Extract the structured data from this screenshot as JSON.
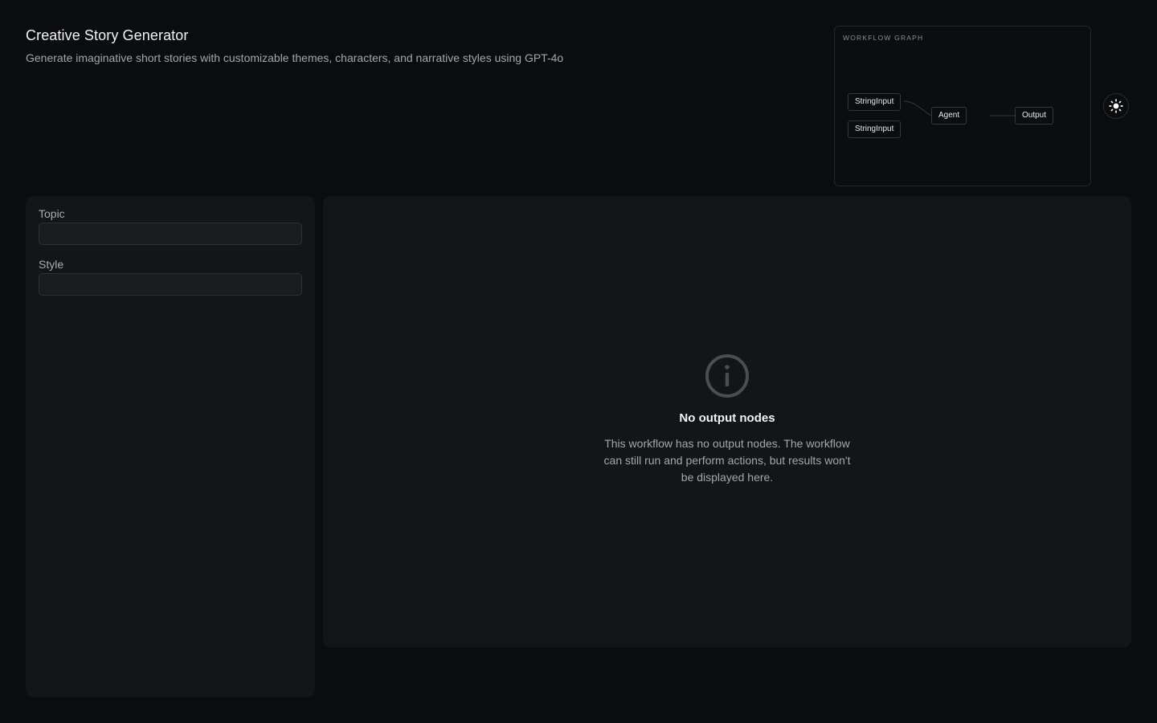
{
  "header": {
    "title": "Creative Story Generator",
    "subtitle": "Generate imaginative short stories with customizable themes, characters, and narrative styles using GPT-4o"
  },
  "workflow_graph": {
    "label": "WORKFLOW GRAPH",
    "nodes": [
      "StringInput",
      "StringInput",
      "Agent",
      "Output"
    ]
  },
  "theme_toggle": {
    "icon": "sun-icon"
  },
  "inputs": {
    "fields": [
      {
        "label": "Topic",
        "value": "",
        "placeholder": ""
      },
      {
        "label": "Style",
        "value": "",
        "placeholder": ""
      }
    ]
  },
  "output": {
    "icon": "info-icon",
    "title": "No output nodes",
    "message": "This workflow has no output nodes. The workflow can still run and perform actions, but results won't be displayed here."
  },
  "colors": {
    "background": "#0b0c0e",
    "panel": "#141518",
    "input": "#1b1c20",
    "muted_text": "#a3a7ae"
  }
}
